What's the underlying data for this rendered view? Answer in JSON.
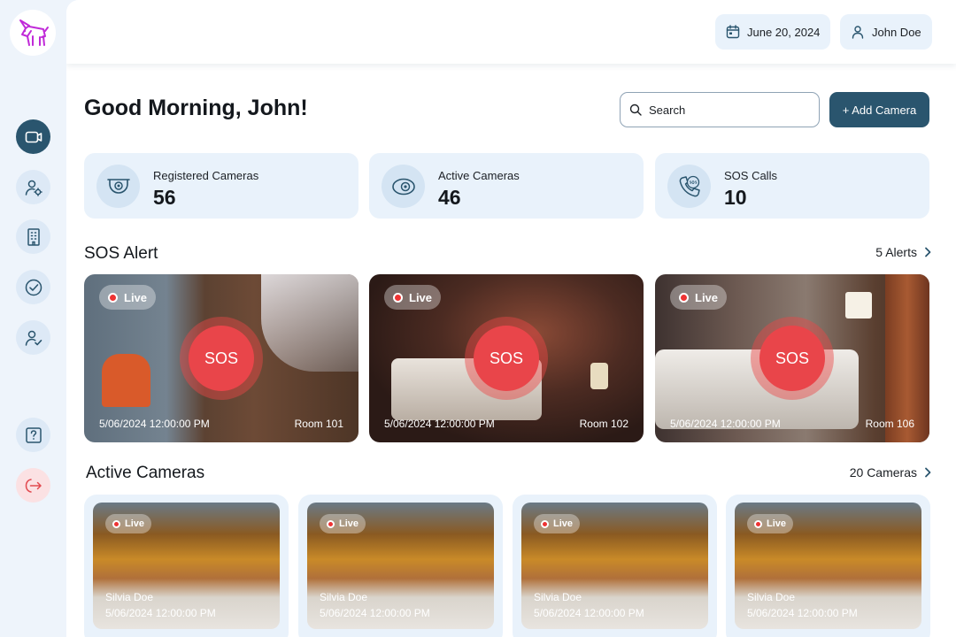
{
  "header": {
    "date": "June 20, 2024",
    "user": "John Doe"
  },
  "sidebar": {
    "items": [
      {
        "icon": "video-camera-icon",
        "active": true
      },
      {
        "icon": "user-settings-icon",
        "active": false
      },
      {
        "icon": "building-icon",
        "active": false
      },
      {
        "icon": "check-circle-icon",
        "active": false
      },
      {
        "icon": "user-check-icon",
        "active": false
      },
      {
        "icon": "help-icon",
        "active": false
      },
      {
        "icon": "logout-icon",
        "active": false
      }
    ]
  },
  "main": {
    "greeting": "Good Morning, John!",
    "search_label": "Search",
    "add_camera_label": "+ Add Camera"
  },
  "stats": [
    {
      "label": "Registered Cameras",
      "value": "56",
      "icon": "cctv-icon"
    },
    {
      "label": "Active Cameras",
      "value": "46",
      "icon": "webcam-icon"
    },
    {
      "label": "SOS Calls",
      "value": "10",
      "icon": "sos-phone-icon"
    }
  ],
  "sos_section": {
    "title": "SOS Alert",
    "link": "5 Alerts",
    "cards": [
      {
        "live": "Live",
        "sos": "SOS",
        "time": "5/06/2024  12:00:00 PM",
        "room": "Room 101"
      },
      {
        "live": "Live",
        "sos": "SOS",
        "time": "5/06/2024  12:00:00 PM",
        "room": "Room 102"
      },
      {
        "live": "Live",
        "sos": "SOS",
        "time": "5/06/2024  12:00:00 PM",
        "room": "Room 106"
      }
    ]
  },
  "active_section": {
    "title": "Active Cameras",
    "link": "20 Cameras",
    "cards": [
      {
        "live": "Live",
        "name": "Silvia Doe",
        "time": "5/06/2024  12:00:00 PM"
      },
      {
        "live": "Live",
        "name": "Silvia Doe",
        "time": "5/06/2024  12:00:00 PM"
      },
      {
        "live": "Live",
        "name": "Silvia Doe",
        "time": "5/06/2024  12:00:00 PM"
      },
      {
        "live": "Live",
        "name": "Silvia Doe",
        "time": "5/06/2024  12:00:00 PM"
      }
    ]
  },
  "colors": {
    "primary": "#2a556e",
    "sos_red": "#e9454a",
    "panel": "#e9f2fb"
  }
}
